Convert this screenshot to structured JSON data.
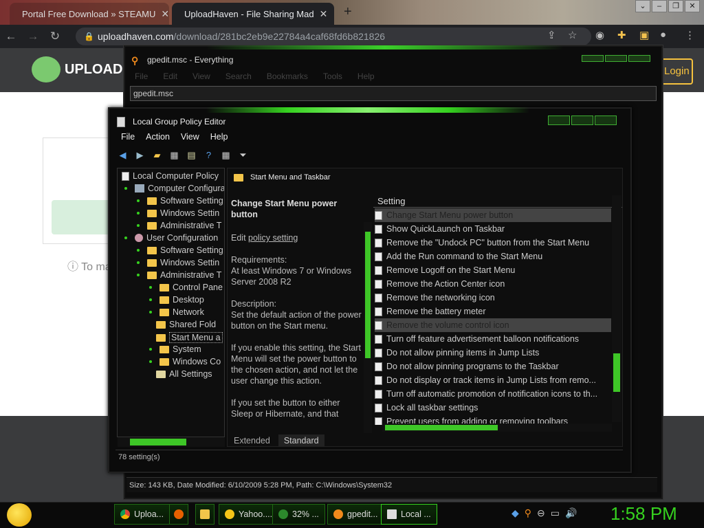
{
  "browser": {
    "tabs": [
      {
        "label": "Portal Free Download » STEAMU"
      },
      {
        "label": "UploadHaven - File Sharing Mad"
      }
    ],
    "url_domain": "uploadhaven.com",
    "url_path": "/download/281bc2eb9e22784a4caf68fd6b821826"
  },
  "webpage": {
    "logo_text": "UPLOADH",
    "login_label": "Login",
    "note_text": "ⓘ To ma"
  },
  "everything": {
    "title": "gpedit.msc - Everything",
    "menu": [
      "File",
      "Edit",
      "View",
      "Search",
      "Bookmarks",
      "Tools",
      "Help"
    ],
    "search_value": "gpedit.msc",
    "status": "Size: 143 KB, Date Modified: 6/10/2009 5:28 PM, Path: C:\\Windows\\System32"
  },
  "gpedit": {
    "title": "Local Group Policy Editor",
    "menu": [
      "File",
      "Action",
      "View",
      "Help"
    ],
    "tree": [
      "Local Computer Policy",
      "Computer Configura",
      "Software Setting",
      "Windows Settin",
      "Administrative T",
      "User Configuration",
      "Software Setting",
      "Windows Settin",
      "Administrative T",
      "Control Pane",
      "Desktop",
      "Network",
      "Shared Fold",
      "Start Menu a",
      "System",
      "Windows Co",
      "All Settings"
    ],
    "pane_title": "Start Menu and Taskbar",
    "description": {
      "heading": "Change Start Menu power button",
      "edit_prefix": "Edit",
      "edit_link": "policy setting",
      "req_label": "Requirements:",
      "req_text": "At least Windows 7 or Windows Server 2008 R2",
      "desc_label": "Description:",
      "p1": "Set the default action of the power button on the Start menu.",
      "p2": "If you enable this setting, the Start Menu will set the power button to the chosen action, and not let the user change this action.",
      "p3": "If you set the button to either Sleep or Hibernate, and that"
    },
    "settings_header": "Setting",
    "settings": [
      "Change Start Menu power button",
      "Show QuickLaunch on Taskbar",
      "Remove the \"Undock PC\" button from the Start Menu",
      "Add the Run command to the Start Menu",
      "Remove Logoff on the Start Menu",
      "Remove the Action Center icon",
      "Remove the networking icon",
      "Remove the battery meter",
      "Remove the volume control icon",
      "Turn off feature advertisement balloon notifications",
      "Do not allow pinning items in Jump Lists",
      "Do not allow pinning programs to the Taskbar",
      "Do not display or track items in Jump Lists from remo...",
      "Turn off automatic promotion of notification icons to th...",
      "Lock all taskbar settings",
      "Prevent users from adding or removing toolbars"
    ],
    "tabs": [
      "Extended",
      "Standard"
    ],
    "status": "78 setting(s)"
  },
  "taskbar": {
    "items": [
      "Uploa...",
      "",
      "",
      "Yahoo....",
      "32% ...",
      "gpedit...",
      "Local ..."
    ],
    "clock": "1:58 PM"
  }
}
